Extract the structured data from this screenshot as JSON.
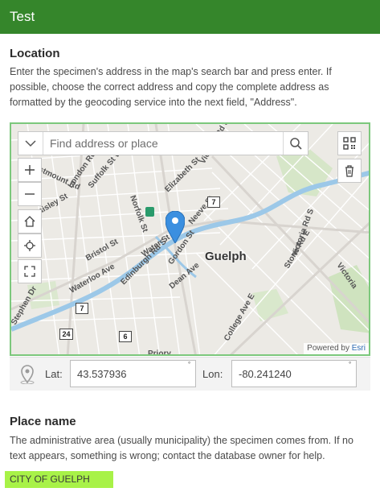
{
  "header": {
    "title": "Test"
  },
  "location": {
    "title": "Location",
    "description": "Enter the specimen's address in the map's search bar and press enter. If possible, choose the correct address and copy the complete address as formatted by the geocoding service into the next field, \"Address\"."
  },
  "map": {
    "search_placeholder": "Find address or place",
    "attribution_prefix": "Powered by ",
    "attribution_brand": "Esri",
    "city_label": "Guelph",
    "road_shield": "7",
    "road_shield_2": "6",
    "road_shield_3": "24",
    "road_shield_4": "7",
    "icons": [
      "expand-icon",
      "search-icon",
      "qr-icon",
      "trash-icon",
      "zoom-in-icon",
      "zoom-out-icon",
      "home-icon",
      "locate-icon",
      "fullscreen-icon",
      "location-pin-icon"
    ]
  },
  "coords": {
    "lat_label": "Lat:",
    "lat_value": "43.537936",
    "lon_label": "Lon:",
    "lon_value": "-80.241240"
  },
  "place": {
    "title": "Place name",
    "description": "The administrative area (usually municipality) the specimen comes from. If no text appears, something is wrong; contact the database owner for help.",
    "value": "CITY OF GUELPH"
  },
  "colors": {
    "header": "#35862b",
    "place_highlight": "#a8f248",
    "map_border": "#7cc87c",
    "pin": "#3b8fe0"
  }
}
